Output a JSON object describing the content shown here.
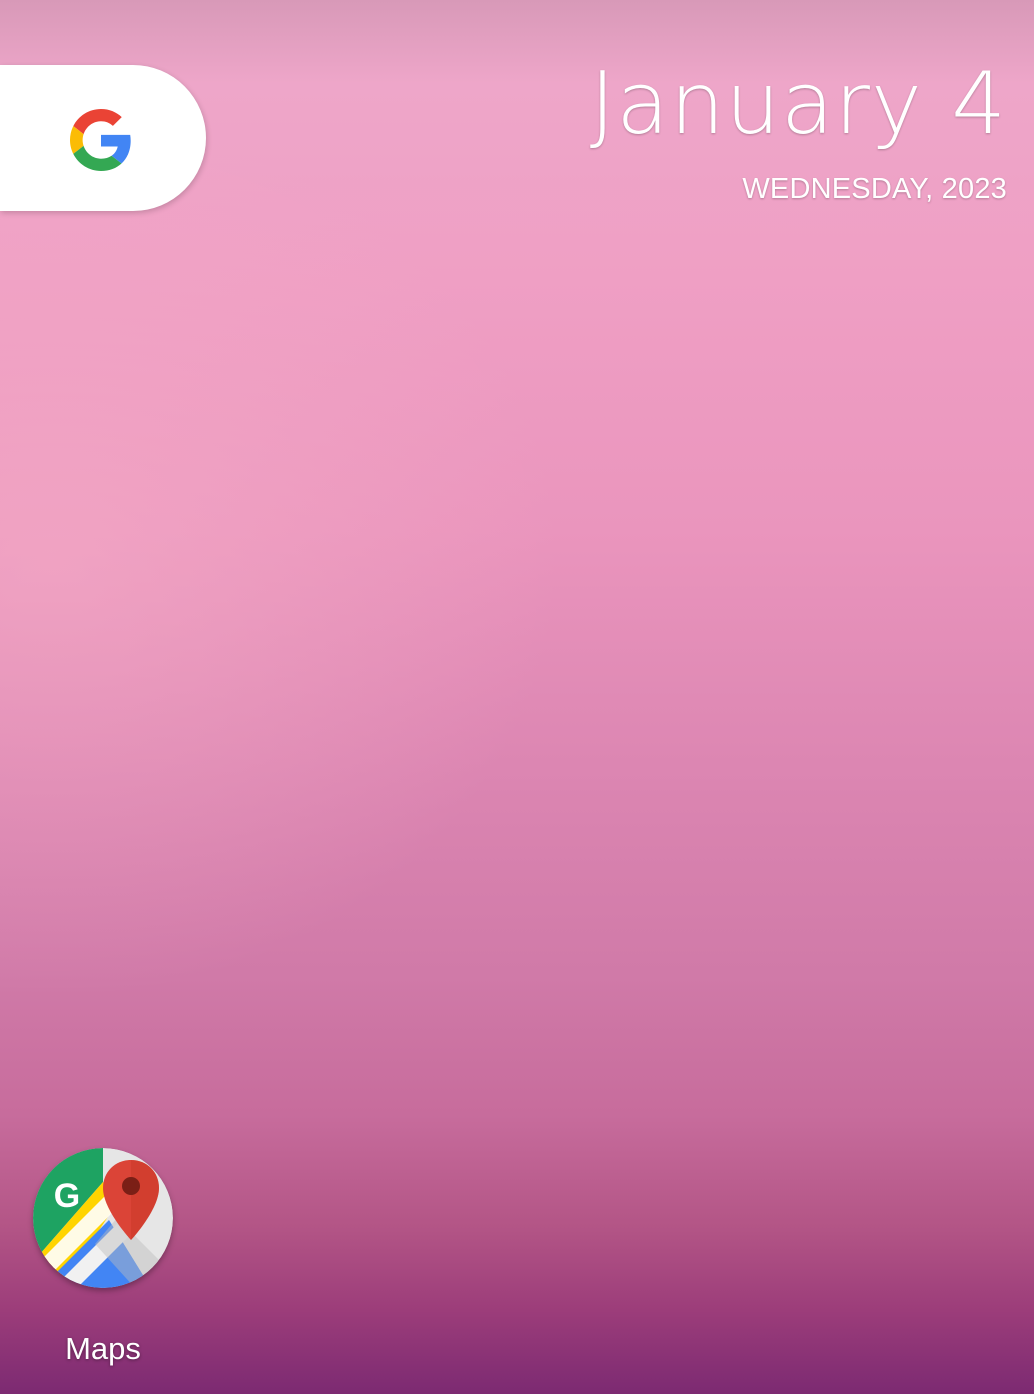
{
  "search_widget": {
    "icon": "google-g-icon"
  },
  "date_widget": {
    "date": "January 4",
    "weekday_year": "WEDNESDAY, 2023"
  },
  "apps": [
    {
      "label": "Maps",
      "icon": "google-maps-icon"
    }
  ],
  "colors": {
    "google_blue": "#4285F4",
    "google_red": "#EA4335",
    "google_yellow": "#FBBC05",
    "google_green": "#34A853"
  }
}
